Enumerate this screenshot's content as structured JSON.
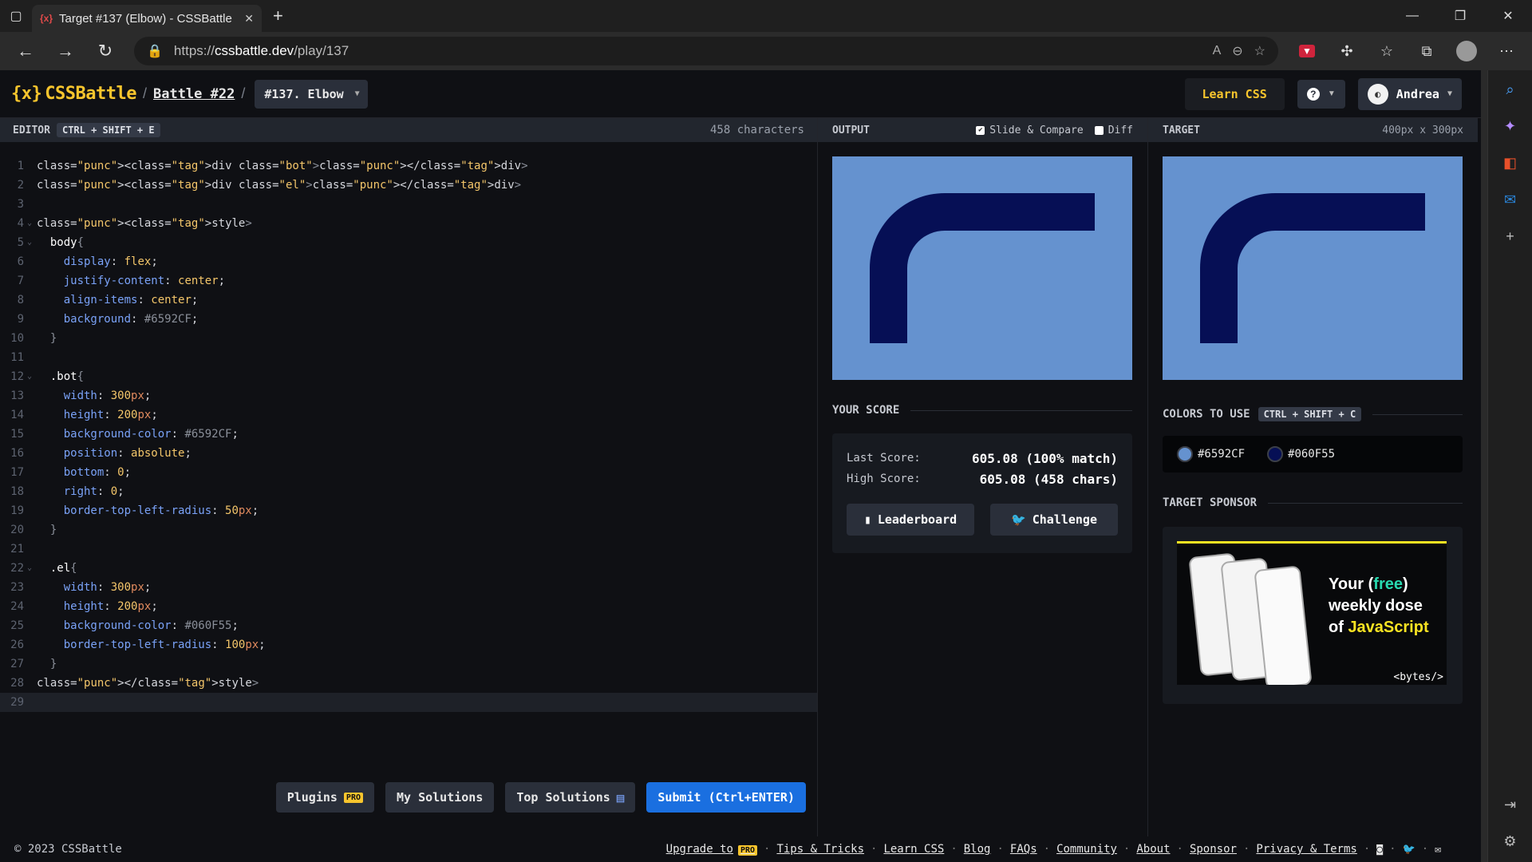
{
  "browser": {
    "tab_title": "Target #137 (Elbow) - CSSBattle",
    "tab_favicon": "{x}",
    "url_prefix": "https://",
    "url_host": "cssbattle.dev",
    "url_path": "/play/137"
  },
  "header": {
    "logo": "CSSBattle",
    "logo_mark": "{x}",
    "battle_link": "Battle #22",
    "target_select": "#137. Elbow",
    "learn_css": "Learn CSS",
    "user_name": "Andrea"
  },
  "editor": {
    "label": "EDITOR",
    "shortcut": "CTRL + SHIFT + E",
    "char_count": "458 characters",
    "lines": [
      {
        "n": "1",
        "code": "<div class=\"bot\"></div>"
      },
      {
        "n": "2",
        "code": "<div class=\"el\"></div>"
      },
      {
        "n": "3",
        "code": ""
      },
      {
        "n": "4",
        "code": "<style>"
      },
      {
        "n": "5",
        "code": "  body{"
      },
      {
        "n": "6",
        "code": "    display: flex;"
      },
      {
        "n": "7",
        "code": "    justify-content: center;"
      },
      {
        "n": "8",
        "code": "    align-items: center;"
      },
      {
        "n": "9",
        "code": "    background: #6592CF;"
      },
      {
        "n": "10",
        "code": "  }"
      },
      {
        "n": "11",
        "code": ""
      },
      {
        "n": "12",
        "code": "  .bot{"
      },
      {
        "n": "13",
        "code": "    width: 300px;"
      },
      {
        "n": "14",
        "code": "    height: 200px;"
      },
      {
        "n": "15",
        "code": "    background-color: #6592CF;"
      },
      {
        "n": "16",
        "code": "    position: absolute;"
      },
      {
        "n": "17",
        "code": "    bottom: 0;"
      },
      {
        "n": "18",
        "code": "    right: 0;"
      },
      {
        "n": "19",
        "code": "    border-top-left-radius: 50px;"
      },
      {
        "n": "20",
        "code": "  }"
      },
      {
        "n": "21",
        "code": ""
      },
      {
        "n": "22",
        "code": "  .el{"
      },
      {
        "n": "23",
        "code": "    width: 300px;"
      },
      {
        "n": "24",
        "code": "    height: 200px;"
      },
      {
        "n": "25",
        "code": "    background-color: #060F55;"
      },
      {
        "n": "26",
        "code": "    border-top-left-radius: 100px;"
      },
      {
        "n": "27",
        "code": "  }"
      },
      {
        "n": "28",
        "code": "</style>"
      },
      {
        "n": "29",
        "code": ""
      }
    ],
    "buttons": {
      "plugins": "Plugins",
      "pro": "PRO",
      "my_solutions": "My Solutions",
      "top_solutions": "Top Solutions",
      "submit": "Submit (Ctrl+ENTER)"
    }
  },
  "output": {
    "label": "OUTPUT",
    "slide_compare": "Slide & Compare",
    "diff": "Diff",
    "score_title": "YOUR SCORE",
    "last_score_label": "Last Score:",
    "last_score_value": "605.08 (100% match)",
    "high_score_label": "High Score:",
    "high_score_value": "605.08 (458 chars)",
    "leaderboard": "Leaderboard",
    "challenge": "Challenge"
  },
  "target": {
    "label": "TARGET",
    "size": "400px x 300px",
    "colors_title": "COLORS TO USE",
    "colors_shortcut": "CTRL + SHIFT + C",
    "colors": [
      "#6592CF",
      "#060F55"
    ],
    "sponsor_title": "TARGET SPONSOR",
    "ad_line1_a": "Your (",
    "ad_line1_b": "free",
    "ad_line1_c": ")",
    "ad_line2": "weekly dose",
    "ad_line3_a": "of ",
    "ad_line3_b": "JavaScript",
    "ad_brand": "<bytes/>"
  },
  "footer": {
    "copyright": "© 2023 CSSBattle",
    "upgrade": "Upgrade to",
    "pro": "PRO",
    "tips": "Tips & Tricks",
    "learn": "Learn CSS",
    "blog": "Blog",
    "faqs": "FAQs",
    "community": "Community",
    "about": "About",
    "sponsor": "Sponsor",
    "privacy": "Privacy & Terms"
  },
  "colors": {
    "accent_yellow": "#f8c52d",
    "submit_blue": "#1a6fe0",
    "target_bg": "#6592CF",
    "target_fg": "#060F55"
  }
}
